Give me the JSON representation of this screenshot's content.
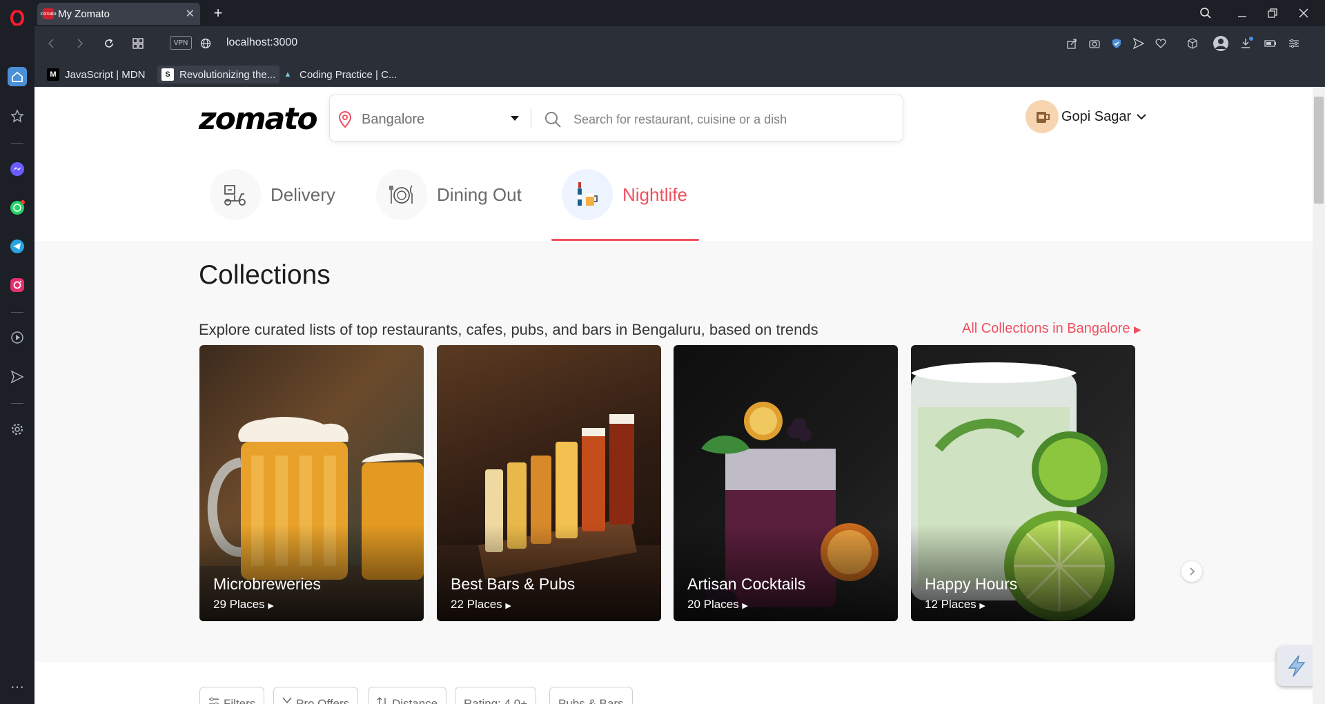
{
  "browser": {
    "tab_title": "My Zomato",
    "tab_favicon_text": "zomato",
    "url": "localhost:3000",
    "vpn_label": "VPN",
    "bookmarks": [
      {
        "label": "JavaScript | MDN",
        "icon": "M"
      },
      {
        "label": "Revolutionizing the...",
        "icon": "S"
      },
      {
        "label": "Coding Practice | C...",
        "icon": "▲"
      }
    ]
  },
  "header": {
    "logo": "zomato",
    "location": "Bangalore",
    "search_placeholder": "Search for restaurant, cuisine or a dish",
    "user_name": "Gopi Sagar"
  },
  "nav_tabs": [
    {
      "label": "Delivery",
      "active": false,
      "icon": "delivery-scooter-icon"
    },
    {
      "label": "Dining Out",
      "active": false,
      "icon": "dining-plate-icon"
    },
    {
      "label": "Nightlife",
      "active": true,
      "icon": "nightlife-drinks-icon"
    }
  ],
  "collections": {
    "title": "Collections",
    "subtitle": "Explore curated lists of top restaurants, cafes, pubs, and bars in Bengaluru, based on trends",
    "all_link": "All Collections in Bangalore",
    "cards": [
      {
        "title": "Microbreweries",
        "places": "29 Places"
      },
      {
        "title": "Best Bars & Pubs",
        "places": "22 Places"
      },
      {
        "title": "Artisan Cocktails",
        "places": "20 Places"
      },
      {
        "title": "Happy Hours",
        "places": "12 Places"
      }
    ]
  },
  "filters": [
    "Filters",
    "Pro Offers",
    "Distance",
    "Rating: 4.0+",
    "Pubs & Bars"
  ],
  "colors": {
    "accent": "#ef4f5f",
    "chrome_dark": "#1c1f26",
    "chrome_mid": "#2b2f38"
  }
}
